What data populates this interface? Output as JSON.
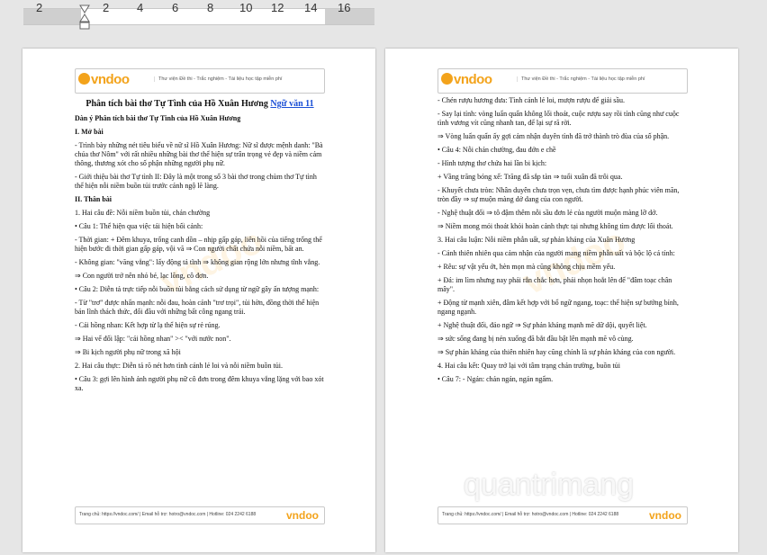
{
  "ruler": {
    "numbers": [
      "2",
      "2",
      "4",
      "6",
      "8",
      "10",
      "12",
      "14",
      "16"
    ]
  },
  "header": {
    "logo": "vndoo",
    "tagline": "Thư viện Đề thi - Trắc nghiệm - Tài liệu học tập miễn phí"
  },
  "footer": {
    "text": "Trang chủ: https://vndoc.com/ | Email hỗ trợ: hotro@vndoc.com | Hotline: 024 2242 6188",
    "logo": "vndoo"
  },
  "page1": {
    "title": "Phân tích bài thơ Tự Tình của Hồ Xuân Hương",
    "title_link": "Ngữ văn 11",
    "paragraphs": [
      "Dàn ý Phân tích bài thơ Tự Tình của Hồ Xuân Hương",
      "I. Mở bài",
      "- Trình bày những nét tiêu biểu về nữ sĩ Hồ Xuân Hương: Nữ sĩ được mệnh danh: \"Bà chúa thơ Nôm\" với rất nhiều những bài thơ thể hiện sự trân trọng vẻ đẹp và niềm cảm thông, thương xót cho số phận những người phụ nữ.",
      "- Giới thiệu bài thơ Tự tình II: Đây là một trong số 3 bài thơ trong chùm thơ Tự tình thể hiện nỗi niềm buồn tủi trước cảnh ngộ lẽ làng.",
      "II. Thân bài",
      "1. Hai câu đề: Nỗi niềm buồn tủi, chán chường",
      "• Câu 1: Thể hiện qua việc tái hiện bối cảnh:",
      "- Thời gian: + Đêm khuya, trống canh dồn – nhịp gấp gáp, liên hồi của tiếng trống thể hiện bước đi thời gian gấp gáp, vội vã ⇒ Con người chất chứa nỗi niềm, bất an.",
      "- Không gian: \"văng vẳng\": lấy động tả tĩnh ⇒ không gian rộng lớn nhưng tĩnh vắng.",
      "⇒ Con người trở nên nhỏ bé, lạc lõng, cô đơn.",
      "• Câu 2: Diễn tả trực tiếp nỗi buồn tủi bằng cách sử dụng từ ngữ gây ấn tượng mạnh:",
      "- Từ \"trơ\" được nhấn mạnh: nỗi đau, hoàn cảnh \"trơ trọi\", tủi hờn, đồng thời thể hiện bản lĩnh thách thức, đối đầu với những bất công ngang trái.",
      "- Cái hồng nhan: Kết hợp từ lạ thể hiện sự rẻ rúng.",
      "⇒ Hai vế đối lập: \"cái hồng nhan\" >< \"với nước non\".",
      "⇒ Bi kịch người phụ nữ trong xã hội",
      "2. Hai câu thực: Diễn tả rõ nét hơn tình cảnh lẻ loi và nỗi niềm buồn tủi.",
      "• Câu 3: gợi lên hình ảnh người phụ nữ cô đơn trong đêm khuya vắng lặng với bao xót xa."
    ]
  },
  "page2": {
    "paragraphs": [
      "- Chén rượu hương đưa: Tình cảnh lẻ loi, mượn rượu để giải sầu.",
      "- Say lại tỉnh: vòng luẩn quẩn không lối thoát, cuộc rượu say rồi tỉnh cũng như cuộc tình vương vít cũng nhanh tan, để lại sự rã rời.",
      "⇒ Vòng luẩn quẩn ấy gợi cảm nhận duyên tình đã trở thành trò đùa của số phận.",
      "• Câu 4: Nỗi chán chường, đau đớn e chề",
      "- Hình tượng thơ chứa hai lần bi kịch:",
      "+ Vầng trăng bóng xế: Trăng đã sắp tàn ⇒ tuổi xuân đã trôi qua.",
      "- Khuyết chưa tròn: Nhân duyên chưa trọn vẹn, chưa tìm được hạnh phúc viên mãn, tròn đầy ⇒ sự muộn màng dở dang của con người.",
      "- Nghệ thuật đối ⇒ tô đậm thêm nỗi sầu đơn lẻ của người muộn màng lỡ dở.",
      "⇒ Niềm mong mỏi thoát khỏi hoàn cảnh thực tại nhưng không tìm được lối thoát.",
      "3. Hai câu luận: Nỗi niềm phẫn uất, sự phản kháng của Xuân Hương",
      "- Cảnh thiên nhiên qua cảm nhận của người mang niềm phẫn uất và bộc lộ cá tính:",
      "+ Rêu: sự vật yếu ớt, hèn mọn mà cũng không chịu mềm yếu.",
      "+ Đá: im lìm nhưng nay phải rắn chắc hơn, phải nhọn hoắt lên để \"đâm toạc chân mây\".",
      "+ Động từ mạnh xiên, đâm kết hợp với bổ ngữ ngang, toạc: thể hiện sự bướng bỉnh, ngang ngạnh.",
      "+ Nghệ thuật đối, đảo ngữ ⇒ Sự phản kháng mạnh mẽ dữ dội, quyết liệt.",
      "⇒ sức sống đang bị nén xuống đã bắt đầu bật lên mạnh mẽ vô cùng.",
      "⇒ Sự phản kháng của thiên nhiên hay cũng chính là sự phản kháng của con người.",
      "4. Hai câu kết: Quay trở lại với tâm trạng chán trường, buồn tủi",
      "• Câu 7: - Ngán: chán ngán, ngán ngẩm."
    ]
  },
  "watermark": "quantrimang"
}
